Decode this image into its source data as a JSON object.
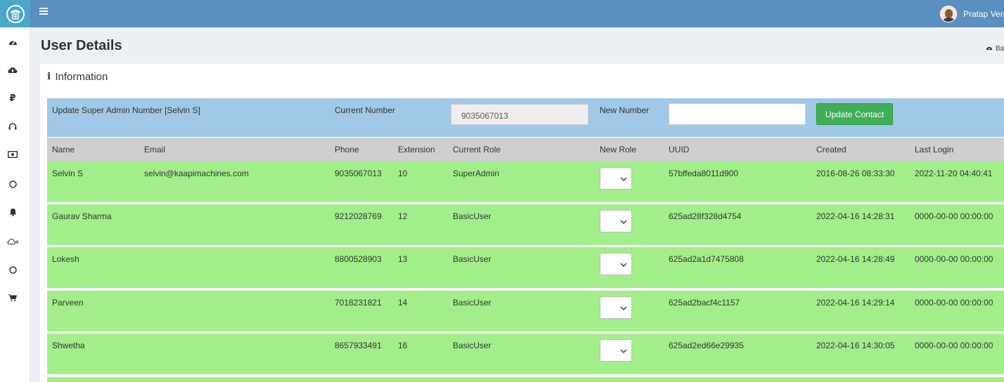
{
  "topbar": {
    "menu_icon": "hamburger-icon",
    "user_name": "Pratap Verma"
  },
  "sidebar": {
    "icons": [
      "dashboard-icon",
      "cloud-upload-icon",
      "ruble-icon",
      "headphones-icon",
      "money-icon",
      "circle-icon",
      "bell-icon",
      "cloud-signal-icon",
      "circle-icon",
      "cart-icon"
    ]
  },
  "page": {
    "title": "User Details",
    "breadcrumb": "Ba"
  },
  "box": {
    "title": "Information"
  },
  "update": {
    "label": "Update Super Admin Number [Selvin S]",
    "current_label": "Current Number",
    "current_value": "9035067013",
    "new_label": "New Number",
    "new_value": "",
    "button_label": "Update Contact"
  },
  "table": {
    "headers": [
      "Name",
      "Email",
      "Phone",
      "Extension",
      "Current Role",
      "New Role",
      "UUID",
      "Created",
      "Last Login"
    ],
    "rows": [
      {
        "name": "Selvin S",
        "email": "selvin@kaapimachines.com",
        "phone": "9035067013",
        "ext": "10",
        "role": "SuperAdmin",
        "uuid": "57bffeda8011d900",
        "created": "2016-08-26 08:33:30",
        "login": "2022-11-20 04:40:41"
      },
      {
        "name": "Gaurav Sharma",
        "email": "",
        "phone": "9212028769",
        "ext": "12",
        "role": "BasicUser",
        "uuid": "625ad28f328d4754",
        "created": "2022-04-16 14:28:31",
        "login": "0000-00-00 00:00:00"
      },
      {
        "name": "Lokesh",
        "email": "",
        "phone": "8800528903",
        "ext": "13",
        "role": "BasicUser",
        "uuid": "625ad2a1d7475808",
        "created": "2022-04-16 14:28:49",
        "login": "0000-00-00 00:00:00"
      },
      {
        "name": "Parveen",
        "email": "",
        "phone": "7018231821",
        "ext": "14",
        "role": "BasicUser",
        "uuid": "625ad2bacf4c1157",
        "created": "2022-04-16 14:29:14",
        "login": "0000-00-00 00:00:00"
      },
      {
        "name": "Shwetha",
        "email": "",
        "phone": "8657933491",
        "ext": "16",
        "role": "BasicUser",
        "uuid": "625ad2ed66e29935",
        "created": "2022-04-16 14:30:05",
        "login": "0000-00-00 00:00:00"
      }
    ]
  },
  "colors": {
    "topbar": "#5a8fc0",
    "update_row": "#9fc9e6",
    "header_row": "#cfcfcf",
    "data_row": "#a2ee8a",
    "button": "#3fae57"
  }
}
